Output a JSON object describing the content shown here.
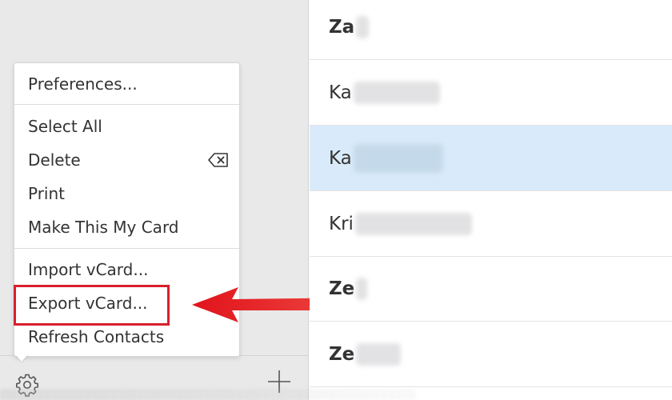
{
  "menu": {
    "items": [
      {
        "label": "Preferences..."
      },
      {
        "label": "Select All"
      },
      {
        "label": "Delete"
      },
      {
        "label": "Print"
      },
      {
        "label": "Make This My Card"
      },
      {
        "label": "Import vCard..."
      },
      {
        "label": "Export vCard..."
      },
      {
        "label": "Refresh Contacts"
      }
    ],
    "highlighted_item": "Export vCard..."
  },
  "contacts": [
    {
      "name": "Za",
      "bold": true
    },
    {
      "name": "Ka",
      "bold": false
    },
    {
      "name": "Ka",
      "bold": false,
      "selected": true
    },
    {
      "name": "Kri",
      "bold": false
    },
    {
      "name": "Ze",
      "bold": true
    },
    {
      "name": "Ze",
      "bold": true
    }
  ],
  "icons": {
    "settings": "gear-icon",
    "add": "plus-icon",
    "delete_key": "delete-backspace-icon"
  },
  "colors": {
    "sidebar_bg": "#e9e9ea",
    "selected_row": "#d9ebfb",
    "annotation_red": "#d8202c"
  }
}
